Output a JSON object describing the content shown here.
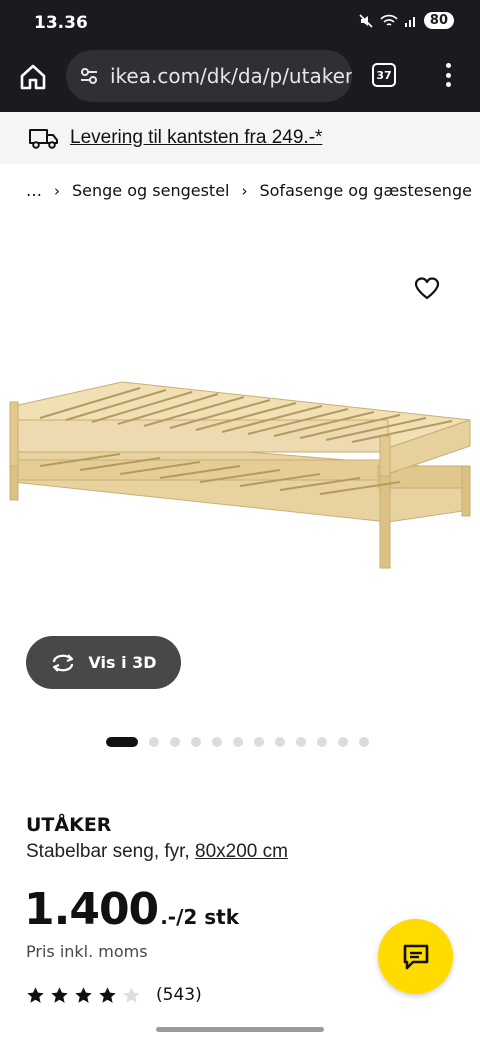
{
  "status": {
    "time": "13.36",
    "battery": "80"
  },
  "browser": {
    "url": "ikea.com/dk/da/p/utaker-",
    "tab_count": "37"
  },
  "delivery": {
    "text": "Levering til kantsten fra 249.-*"
  },
  "breadcrumb": {
    "ellipsis": "…",
    "items": [
      "Senge og sengestel",
      "Sofasenge og gæstesenge"
    ]
  },
  "gallery": {
    "view_3d_label": "Vis i 3D",
    "image_count": 12,
    "active_index": 0
  },
  "product": {
    "name": "UTÅKER",
    "description": "Stabelbar seng, fyr,",
    "size": "80x200 cm",
    "price": "1.400",
    "price_suffix": ".-/2 stk",
    "vat_note": "Pris inkl. moms",
    "rating_value": 4,
    "rating_max": 5,
    "review_count": "(543)"
  },
  "colors": {
    "accent_yellow": "#ffdb00",
    "button_dark": "#484848",
    "wood": "#ecd9a6"
  }
}
